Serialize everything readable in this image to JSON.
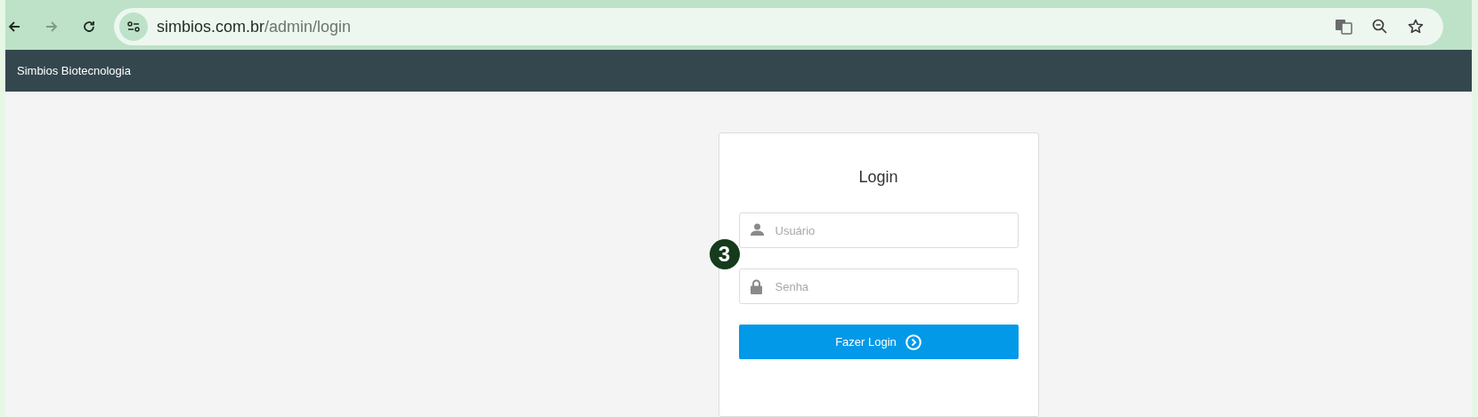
{
  "browser": {
    "url_host": "simbios.com.br",
    "url_path": "/admin/login"
  },
  "navbar": {
    "brand": "Simbios Biotecnologia"
  },
  "login": {
    "title": "Login",
    "fields": [
      {
        "kind": "user",
        "placeholder": "Usuário"
      },
      {
        "kind": "password",
        "placeholder": "Senha"
      }
    ],
    "button": "Fazer Login"
  },
  "annotation_marker": "3"
}
